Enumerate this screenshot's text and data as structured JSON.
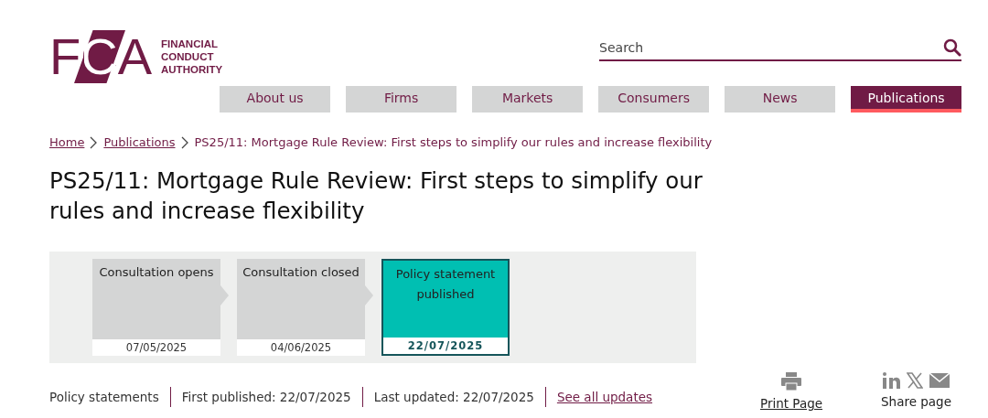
{
  "logo": {
    "letters": "FCA",
    "name_lines": [
      "FINANCIAL",
      "CONDUCT",
      "AUTHORITY"
    ]
  },
  "search": {
    "placeholder": "Search"
  },
  "nav": [
    {
      "label": "About us",
      "selected": false
    },
    {
      "label": "Firms",
      "selected": false
    },
    {
      "label": "Markets",
      "selected": false
    },
    {
      "label": "Consumers",
      "selected": false
    },
    {
      "label": "News",
      "selected": false
    },
    {
      "label": "Publications",
      "selected": true
    }
  ],
  "breadcrumb": {
    "links": [
      "Home",
      "Publications"
    ],
    "current": "PS25/11: Mortgage Rule Review: First steps to simplify our rules and increase flexibility"
  },
  "title": "PS25/11: Mortgage Rule Review: First steps to simplify our rules and increase flexibility",
  "timeline": [
    {
      "label": "Consultation opens",
      "date": "07/05/2025",
      "selected": false
    },
    {
      "label": "Consultation closed",
      "date": "04/06/2025",
      "selected": false
    },
    {
      "label": "Policy statement published",
      "date": "22/07/2025",
      "selected": true
    }
  ],
  "meta": {
    "type": "Policy statements",
    "first_published": "First published: 22/07/2025",
    "last_updated": "Last updated: 22/07/2025",
    "link": "See all updates"
  },
  "actions": {
    "print": "Print Page",
    "share": "Share page"
  }
}
